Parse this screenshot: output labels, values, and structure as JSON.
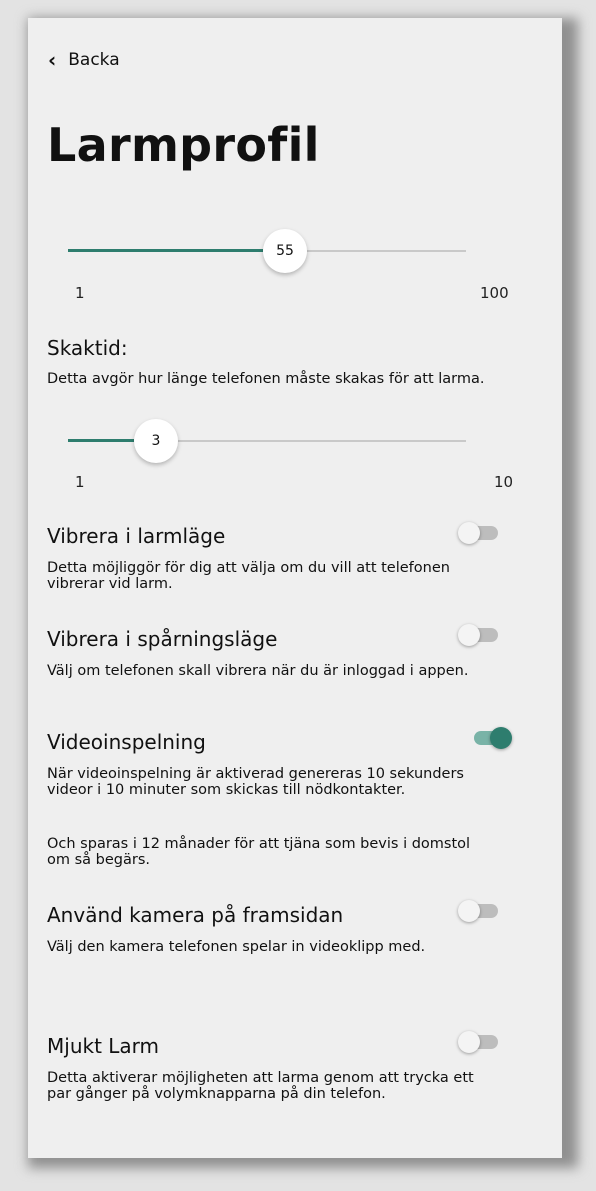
{
  "nav": {
    "back_label": "Backa"
  },
  "page": {
    "title": "Larmprofil"
  },
  "sensitivity_slider": {
    "value": 55,
    "min": 1,
    "max": 100,
    "min_label": "1",
    "max_label": "100",
    "value_label": "55"
  },
  "shake_time": {
    "heading": "Skaktid:",
    "description": "Detta avgör hur länge telefonen måste skakas för att larma.",
    "slider": {
      "value": 3,
      "min": 1,
      "max": 10,
      "min_label": "1",
      "max_label": "10",
      "value_label": "3"
    }
  },
  "settings": [
    {
      "heading": "Vibrera i larmläge",
      "description": "Detta möjliggör för dig att välja om du vill att telefonen vibrerar vid larm.",
      "enabled": false
    },
    {
      "heading": "Vibrera i spårningsläge",
      "description": "Välj om telefonen skall vibrera när du är inloggad i appen.",
      "enabled": false
    },
    {
      "heading": "Videoinspelning",
      "description": "När videoinspelning är aktiverad genereras 10 sekunders videor i 10 minuter som skickas till nödkontakter.",
      "description2": "Och sparas i 12 månader för att tjäna som bevis i domstol om så begärs.",
      "enabled": true
    },
    {
      "heading": "Använd kamera på framsidan",
      "description": "Välj den kamera telefonen spelar in videoklipp med.",
      "enabled": false
    },
    {
      "heading": "Mjukt Larm",
      "description": "Detta aktiverar möjligheten att larma genom att trycka ett par gånger på volymknapparna på din telefon.",
      "enabled": false
    }
  ],
  "colors": {
    "accent": "#2e7d6e",
    "panel": "#efefef",
    "toggle_off": "#bdbdbd"
  }
}
